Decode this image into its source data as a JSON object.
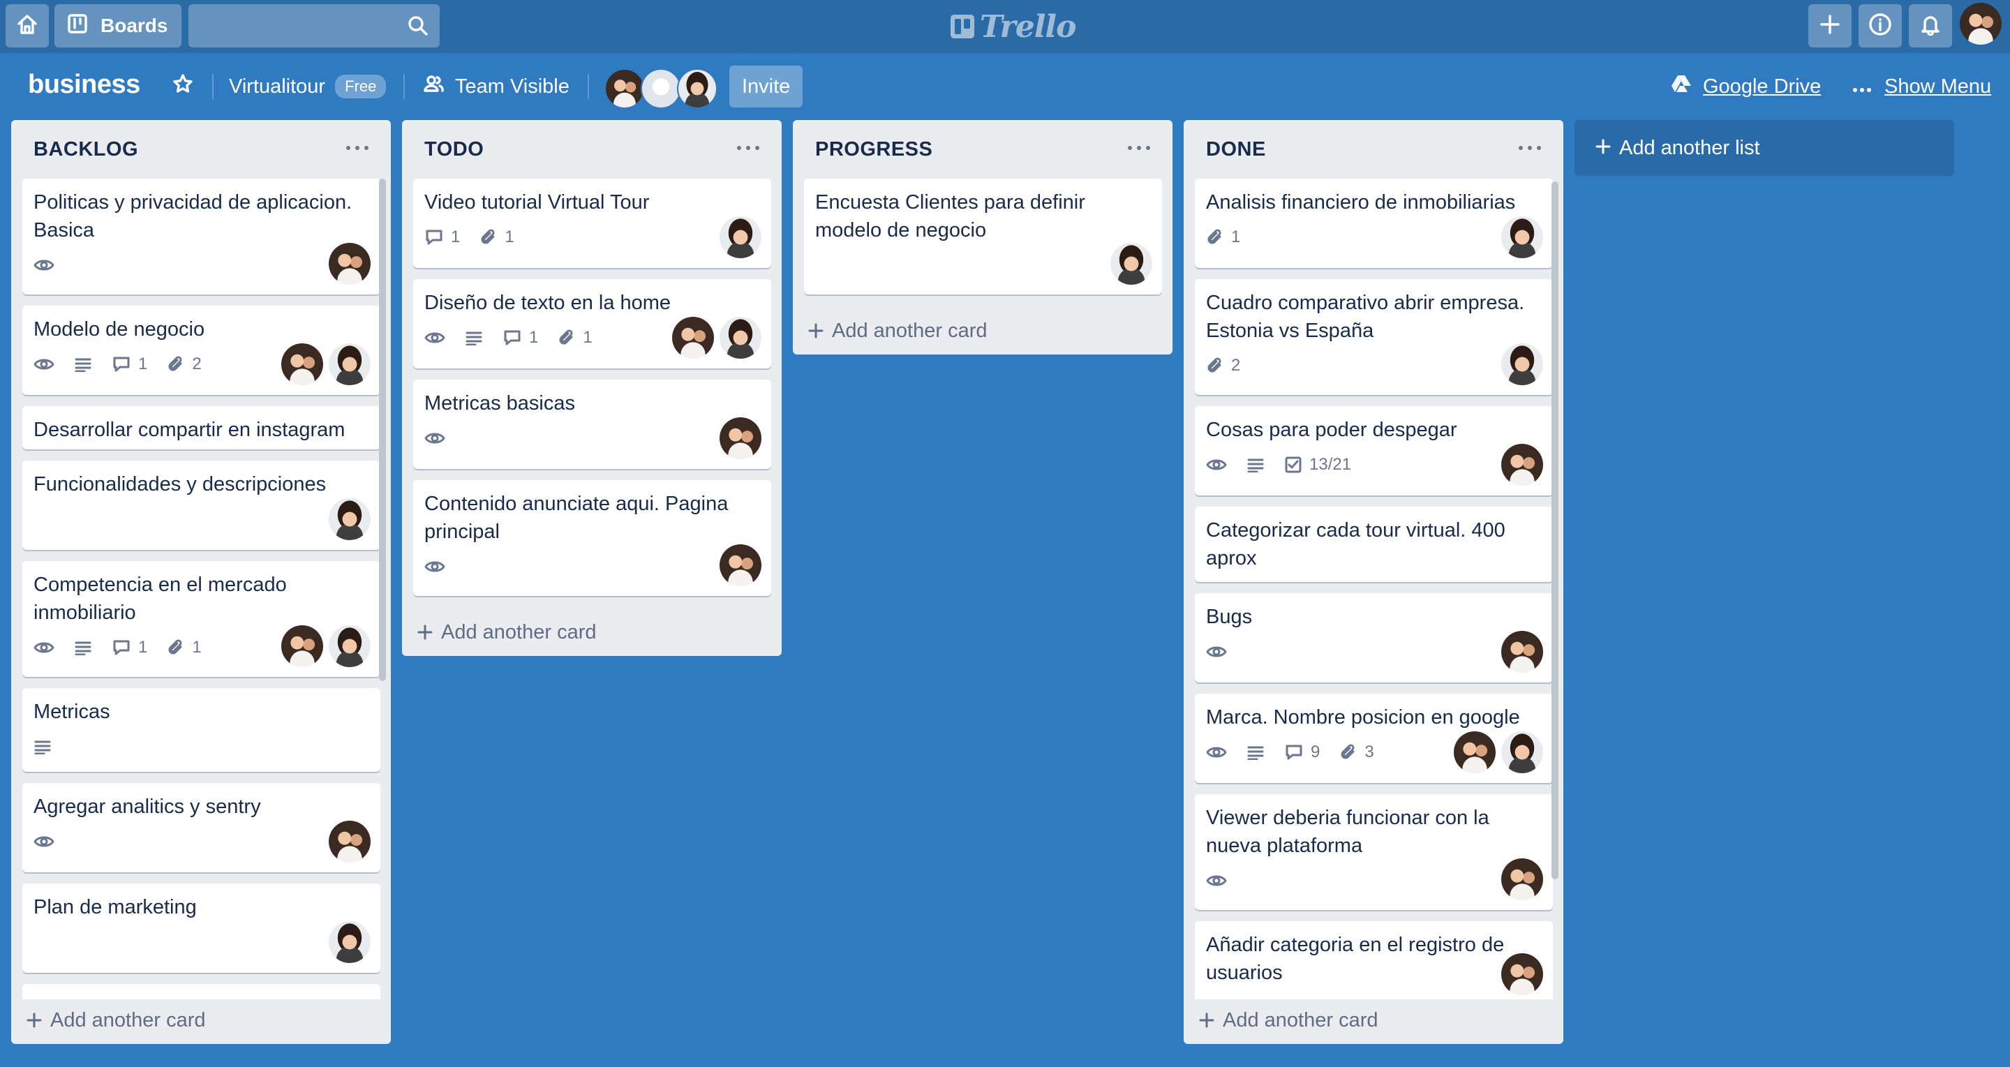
{
  "header": {
    "boards_label": "Boards",
    "search_placeholder": "",
    "logo_text": "Trello"
  },
  "board": {
    "title": "business",
    "team_name": "Virtualitour",
    "team_plan": "Free",
    "visibility": "Team Visible",
    "invite_label": "Invite",
    "power_up_label": "Google Drive",
    "menu_label": "Show Menu"
  },
  "lists": [
    {
      "title": "BACKLOG",
      "add_card_label": "Add another card",
      "cards": [
        {
          "title": "Politicas y privacidad de aplicacion. Basica",
          "watch": true,
          "avatars": [
            "a"
          ]
        },
        {
          "title": "Modelo de negocio",
          "watch": true,
          "description": true,
          "comments": "1",
          "attachments": "2",
          "avatars": [
            "a",
            "b"
          ]
        },
        {
          "title": "Desarrollar compartir en instagram"
        },
        {
          "title": "Funcionalidades y descripciones",
          "avatars": [
            "b"
          ]
        },
        {
          "title": "Competencia en el mercado inmobiliario",
          "watch": true,
          "description": true,
          "comments": "1",
          "attachments": "1",
          "avatars": [
            "a",
            "b"
          ]
        },
        {
          "title": "Metricas",
          "description": true
        },
        {
          "title": "Agregar analitics y sentry",
          "watch": true,
          "avatars": [
            "a"
          ]
        },
        {
          "title": "Plan de marketing",
          "avatars": [
            "b"
          ]
        },
        {
          "title": ""
        }
      ]
    },
    {
      "title": "TODO",
      "add_card_label": "Add another card",
      "cards": [
        {
          "title": "Video tutorial Virtual Tour",
          "comments": "1",
          "attachments": "1",
          "avatars": [
            "b"
          ]
        },
        {
          "title": "Diseño de texto en la home",
          "watch": true,
          "description": true,
          "comments": "1",
          "attachments": "1",
          "avatars": [
            "a",
            "b"
          ]
        },
        {
          "title": "Metricas basicas",
          "watch": true,
          "avatars": [
            "a"
          ]
        },
        {
          "title": "Contenido anunciate aqui. Pagina principal",
          "watch": true,
          "avatars": [
            "a"
          ]
        }
      ]
    },
    {
      "title": "PROGRESS",
      "add_card_label": "Add another card",
      "cards": [
        {
          "title": "Encuesta Clientes para definir modelo de negocio",
          "avatars": [
            "b"
          ]
        }
      ]
    },
    {
      "title": "DONE",
      "add_card_label": "Add another card",
      "cards": [
        {
          "title": "Analisis financiero de inmobiliarias",
          "attachments": "1",
          "avatars": [
            "b"
          ]
        },
        {
          "title": "Cuadro comparativo abrir empresa. Estonia vs España",
          "attachments": "2",
          "avatars": [
            "b"
          ]
        },
        {
          "title": "Cosas para poder despegar",
          "watch": true,
          "description": true,
          "checklist": "13/21",
          "avatars": [
            "a"
          ]
        },
        {
          "title": "Categorizar cada tour virtual. 400 aprox"
        },
        {
          "title": "Bugs",
          "watch": true,
          "avatars": [
            "a"
          ]
        },
        {
          "title": "Marca. Nombre posicion en google",
          "watch": true,
          "description": true,
          "comments": "9",
          "attachments": "3",
          "avatars": [
            "a",
            "b"
          ]
        },
        {
          "title": "Viewer deberia funcionar con la nueva plataforma",
          "watch": true,
          "avatars": [
            "a"
          ]
        },
        {
          "title": "Añadir categoria en el registro de usuarios",
          "avatars": [
            "a"
          ]
        }
      ]
    }
  ],
  "add_list_label": "Add another list"
}
